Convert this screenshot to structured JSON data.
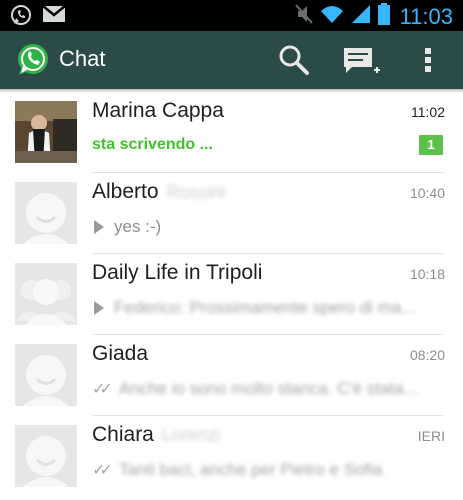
{
  "status_bar": {
    "time": "11:03",
    "colors": {
      "background": "#000000",
      "time": "#38b6ff",
      "icons": "#38b6ff"
    },
    "icons": [
      "whatsapp-notification-icon",
      "gmail-notification-icon",
      "mute-icon",
      "wifi-icon",
      "signal-icon",
      "battery-icon"
    ]
  },
  "action_bar": {
    "title": "Chat",
    "colors": {
      "background": "#2b4b48",
      "title": "#ffffff",
      "logo": "#2fb247"
    },
    "icons": [
      "whatsapp-logo-icon",
      "search-icon",
      "new-chat-icon",
      "overflow-menu-icon"
    ]
  },
  "chats": [
    {
      "name": "Marina Cappa",
      "name_suffix": "",
      "time": "11:02",
      "preview": "sta scrivendo ...",
      "status": "typing",
      "unread": "1",
      "avatar": "photo"
    },
    {
      "name": "Alberto",
      "name_suffix": "Rossini",
      "time": "10:40",
      "preview": "yes :-)",
      "status": "voice",
      "unread": "",
      "avatar": "default"
    },
    {
      "name": "Daily Life in Tripoli",
      "name_suffix": "",
      "time": "10:18",
      "preview": "Federico: Prossimamente spero di ma...",
      "status": "voice",
      "unread": "",
      "avatar": "group"
    },
    {
      "name": "Giada",
      "name_suffix": "",
      "time": "08:20",
      "preview": "Anche io sono molto stanca. C'è stata...",
      "status": "delivered",
      "unread": "",
      "avatar": "default"
    },
    {
      "name": "Chiara",
      "name_suffix": "Lorenzi",
      "time": "IERI",
      "preview": "Tanti baci, anche per Pietro e Sofia",
      "status": "delivered",
      "unread": "",
      "avatar": "default"
    }
  ],
  "colors": {
    "typing": "#3ec32a",
    "badge": "#5cc04b",
    "secondary_text": "#8e8e8e",
    "divider": "#e3e3e3"
  }
}
